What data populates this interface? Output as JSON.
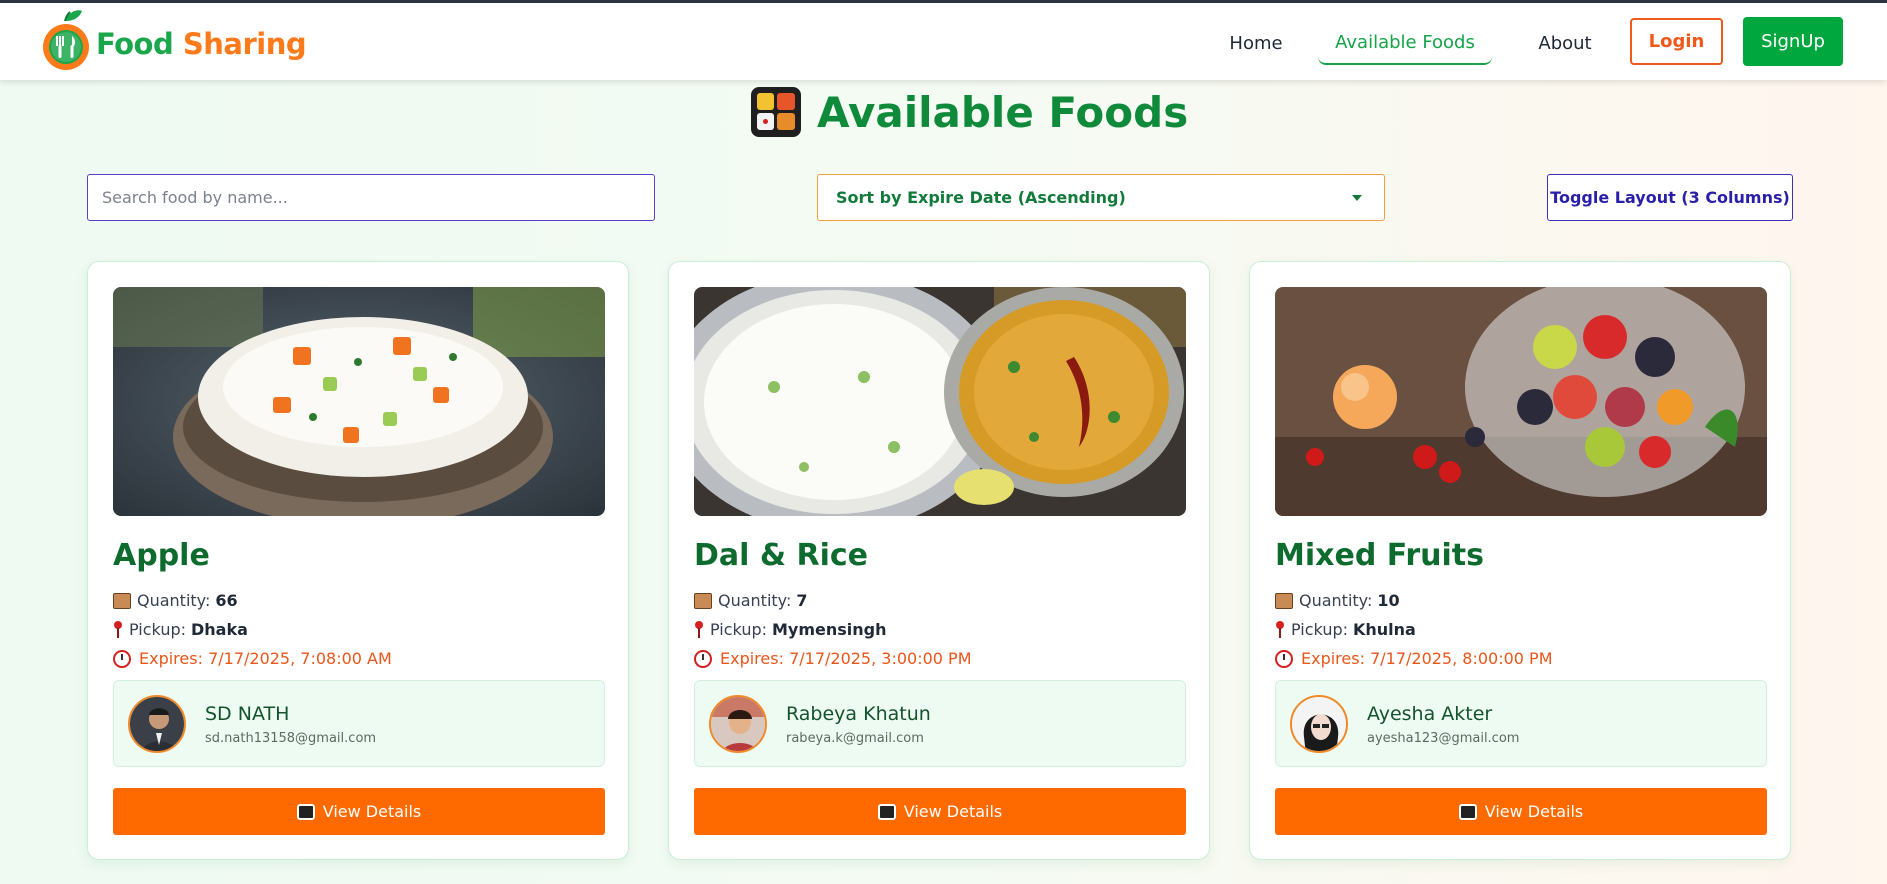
{
  "brand": {
    "word1": "Food",
    "word2": "Sharing"
  },
  "nav": {
    "home": "Home",
    "available": "Available Foods",
    "about": "About",
    "login": "Login",
    "signup": "SignUp"
  },
  "page": {
    "title": "Available Foods",
    "search_placeholder": "Search food by name...",
    "sort_label": "Sort by Expire Date (Ascending)",
    "toggle_label": "Toggle Layout (3 Columns)"
  },
  "cards": [
    {
      "name": "Apple",
      "quantity_label": "Quantity:",
      "quantity": "66",
      "pickup_label": "Pickup:",
      "pickup": "Dhaka",
      "expires": "Expires: 7/17/2025, 7:08:00 AM",
      "donor_name": "SD NATH",
      "donor_email": "sd.nath13158@gmail.com",
      "button": "View Details"
    },
    {
      "name": "Dal & Rice",
      "quantity_label": "Quantity:",
      "quantity": "7",
      "pickup_label": "Pickup:",
      "pickup": "Mymensingh",
      "expires": "Expires: 7/17/2025, 3:00:00 PM",
      "donor_name": "Rabeya Khatun",
      "donor_email": "rabeya.k@gmail.com",
      "button": "View Details"
    },
    {
      "name": "Mixed Fruits",
      "quantity_label": "Quantity:",
      "quantity": "10",
      "pickup_label": "Pickup:",
      "pickup": "Khulna",
      "expires": "Expires: 7/17/2025, 8:00:00 PM",
      "donor_name": "Ayesha Akter",
      "donor_email": "ayesha123@gmail.com",
      "button": "View Details"
    }
  ],
  "colors": {
    "brand_green": "#1aa64a",
    "brand_orange": "#ff7a1a",
    "title_green": "#0f8a3a",
    "button_orange": "#ff6a00",
    "signup_green": "#00a63e"
  }
}
